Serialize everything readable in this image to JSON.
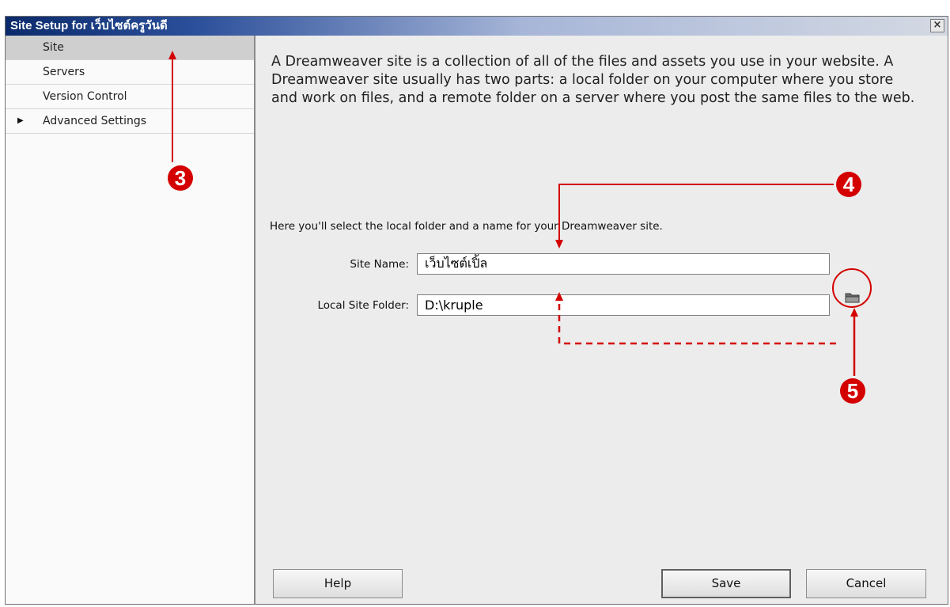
{
  "window": {
    "title": "Site Setup for เว็บไซต์ครูวันดี",
    "close_glyph": "×"
  },
  "sidebar": {
    "items": [
      {
        "label": "Site",
        "selected": true
      },
      {
        "label": "Servers"
      },
      {
        "label": "Version Control"
      },
      {
        "label": "Advanced Settings",
        "expander": "▶"
      }
    ]
  },
  "main": {
    "intro": "A Dreamweaver site is a collection of all of the files and assets you use in your website. A Dreamweaver site usually has two parts: a local folder on your computer where you store and work on files, and a remote folder on a server where you post the same files to the web.",
    "select_text": "Here you'll select the local folder and a name for your Dreamweaver site.",
    "site_name": {
      "label": "Site Name:",
      "value": "เว็บไซต์เปิ้ล"
    },
    "local_folder": {
      "label": "Local Site Folder:",
      "value": "D:\\kruple",
      "browse_icon": "folder-icon"
    }
  },
  "buttons": {
    "help": "Help",
    "save": "Save",
    "cancel": "Cancel"
  },
  "annotations": {
    "badges": [
      "3",
      "4",
      "5"
    ],
    "color": "#d40000"
  }
}
